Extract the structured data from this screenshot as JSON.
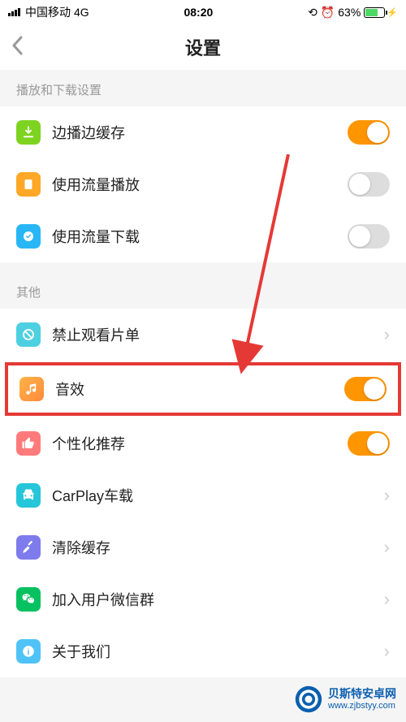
{
  "status": {
    "carrier": "中国移动",
    "network": "4G",
    "time": "08:20",
    "battery_pct": "63%"
  },
  "nav": {
    "title": "设置"
  },
  "sections": {
    "playback": {
      "header": "播放和下载设置"
    },
    "other": {
      "header": "其他"
    }
  },
  "rows": {
    "cache_while_play": {
      "label": "边播边缓存",
      "toggle": true
    },
    "cellular_play": {
      "label": "使用流量播放",
      "toggle": false
    },
    "cellular_download": {
      "label": "使用流量下载",
      "toggle": false
    },
    "block_playlist": {
      "label": "禁止观看片单"
    },
    "sound_effect": {
      "label": "音效",
      "toggle": true
    },
    "personalization": {
      "label": "个性化推荐",
      "toggle": true
    },
    "carplay": {
      "label": "CarPlay车载"
    },
    "clear_cache": {
      "label": "清除缓存"
    },
    "wechat_group": {
      "label": "加入用户微信群"
    },
    "about": {
      "label": "关于我们"
    }
  },
  "watermark": {
    "name": "贝斯特安卓网",
    "url": "www.zjbstyy.com"
  }
}
